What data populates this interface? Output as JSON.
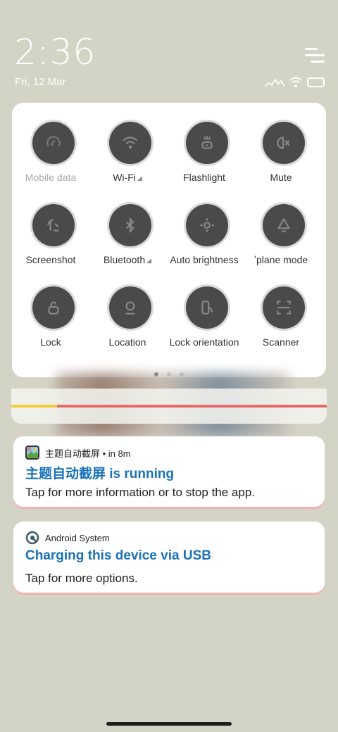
{
  "status": {
    "time": "2:36",
    "date": "Fri, 12 Mar",
    "icons": [
      "signal-icon",
      "wifi-icon",
      "battery-icon"
    ]
  },
  "quick_settings": {
    "tiles": [
      {
        "label": "Mobile data",
        "icon": "mobile-data-icon",
        "enabled": false
      },
      {
        "label": "Wi-Fi",
        "icon": "wifi-icon",
        "expandable": true
      },
      {
        "label": "Flashlight",
        "icon": "flashlight-icon"
      },
      {
        "label": "Mute",
        "icon": "mute-icon"
      },
      {
        "label": "Screenshot",
        "icon": "screenshot-icon"
      },
      {
        "label": "Bluetooth",
        "icon": "bluetooth-icon",
        "expandable": true
      },
      {
        "label": "Auto brightness",
        "icon": "brightness-icon"
      },
      {
        "label": "ʼplane mode",
        "icon": "airplane-icon"
      },
      {
        "label": "Lock",
        "icon": "lock-icon"
      },
      {
        "label": "Location",
        "icon": "location-icon"
      },
      {
        "label": "Lock orientation",
        "icon": "rotation-lock-icon"
      },
      {
        "label": "Scanner",
        "icon": "scanner-icon"
      }
    ],
    "page_indicator": {
      "pages": 3,
      "active": 0
    }
  },
  "media": {
    "progress": 0.145,
    "colors": {
      "fill": "#f1cb3a",
      "track": "#e56b6b"
    }
  },
  "notifications": [
    {
      "app_name": "主题自动截屏 • in 8m",
      "app_icon": "theme-screenshot-app-icon",
      "title": "主题自动截屏 is running",
      "text": "Tap for more information or to stop the app."
    },
    {
      "app_name": "Android System",
      "app_icon": "android-system-icon",
      "title": "Charging this device via USB",
      "text": "Tap for more options."
    }
  ],
  "colors": {
    "background": "#d3d3c6",
    "accent": "#1a73b8",
    "tile": "#4a4a4a"
  }
}
